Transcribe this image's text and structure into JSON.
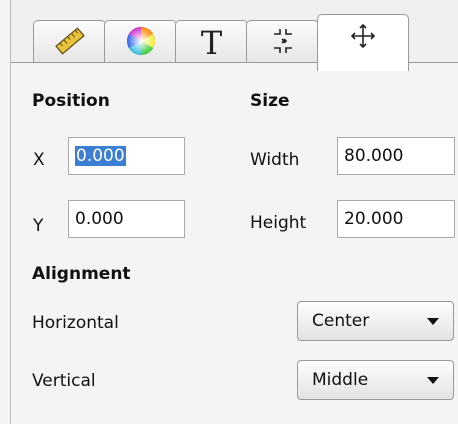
{
  "tabs": [
    {
      "icon": "ruler-icon"
    },
    {
      "icon": "color-wheel-icon"
    },
    {
      "icon": "text-icon",
      "label": "T"
    },
    {
      "icon": "collapse-arrows-icon"
    },
    {
      "icon": "move-icon",
      "active": true
    }
  ],
  "position": {
    "title": "Position",
    "x_label": "X",
    "x_value": "0.000",
    "y_label": "Y",
    "y_value": "0.000"
  },
  "size": {
    "title": "Size",
    "width_label": "Width",
    "width_value": "80.000",
    "height_label": "Height",
    "height_value": "20.000"
  },
  "alignment": {
    "title": "Alignment",
    "horizontal_label": "Horizontal",
    "horizontal_value": "Center",
    "vertical_label": "Vertical",
    "vertical_value": "Middle"
  },
  "colors": {
    "selection": "#3b7fd4",
    "ruler": "#e8c23a"
  }
}
